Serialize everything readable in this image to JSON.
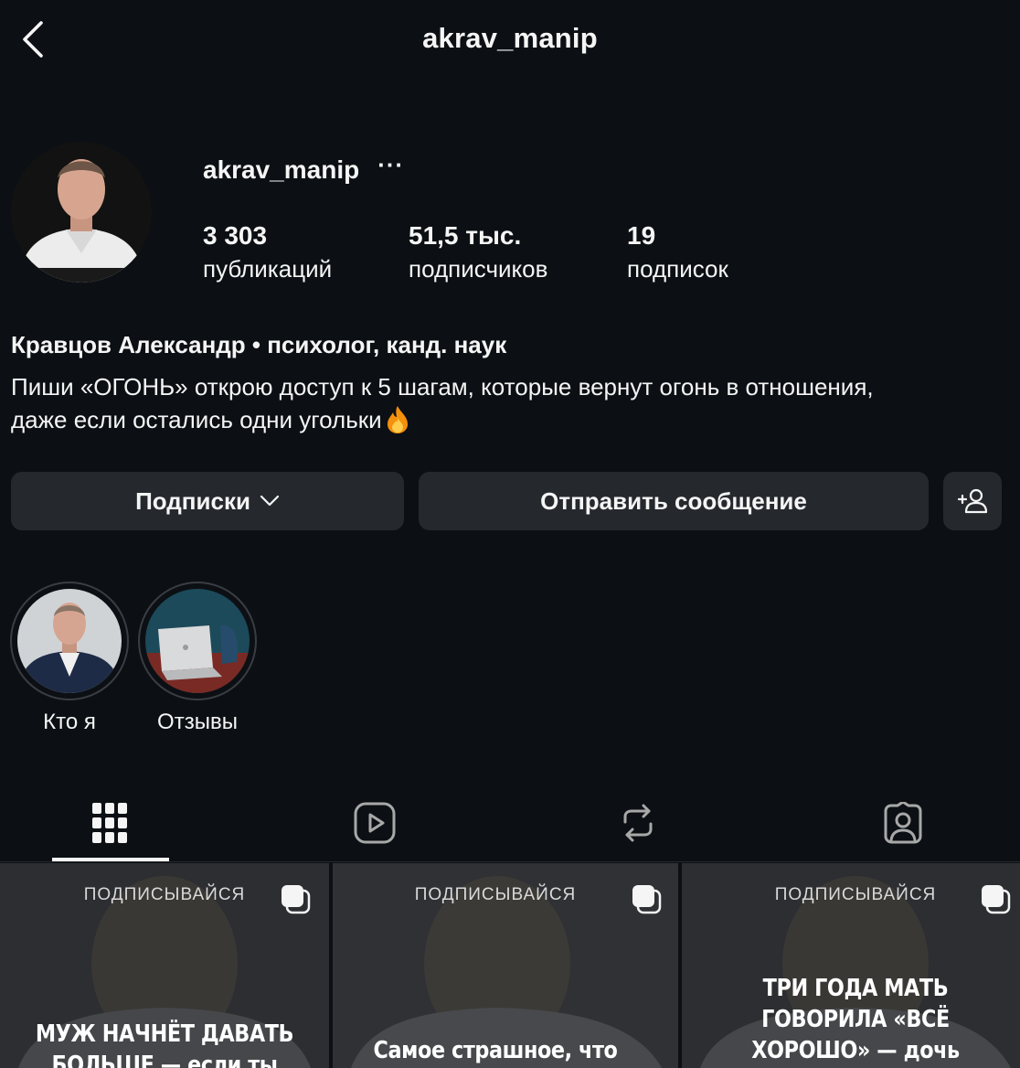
{
  "header": {
    "title": "akrav_manip"
  },
  "profile": {
    "username": "akrav_manip",
    "more_label": "···",
    "stats": [
      {
        "value": "3 303",
        "label": "публикаций"
      },
      {
        "value": "51,5 тыс.",
        "label": "подписчиков"
      },
      {
        "value": "19",
        "label": "подписок"
      }
    ],
    "name": "Кравцов Александр • психолог, канд. наук",
    "bio_line1": "Пиши «ОГОНЬ» открою доступ к 5 шагам, которые вернут огонь в отношения,",
    "bio_line2": "даже если остались одни угольки",
    "bio_emoji": "fire-icon"
  },
  "actions": {
    "following_label": "Подписки",
    "message_label": "Отправить сообщение",
    "add_user_icon": "add-user-icon"
  },
  "highlights": [
    {
      "label": "Кто я"
    },
    {
      "label": "Отзывы"
    }
  ],
  "tabs": [
    {
      "icon": "grid-icon",
      "active": true
    },
    {
      "icon": "reels-icon",
      "active": false
    },
    {
      "icon": "reposts-icon",
      "active": false
    },
    {
      "icon": "tagged-icon",
      "active": false
    }
  ],
  "posts": [
    {
      "tag": "ПОДПИСЫВАЙСЯ",
      "caption_line1": "МУЖ НАЧНЁТ ДАВАТЬ",
      "caption_line2": "БОЛЬШЕ — если ты"
    },
    {
      "tag": "ПОДПИСЫВАЙСЯ",
      "caption_line1": "Самое страшное, что"
    },
    {
      "tag": "ПОДПИСЫВАЙСЯ",
      "caption_line1": "ТРИ ГОДА МАТЬ",
      "caption_line2": "ГОВОРИЛА «ВСЁ",
      "caption_line3": "ХОРОШО» — дочь"
    }
  ],
  "colors": {
    "background": "#0c1014",
    "button": "#25292e",
    "text": "#f5f5f5"
  }
}
